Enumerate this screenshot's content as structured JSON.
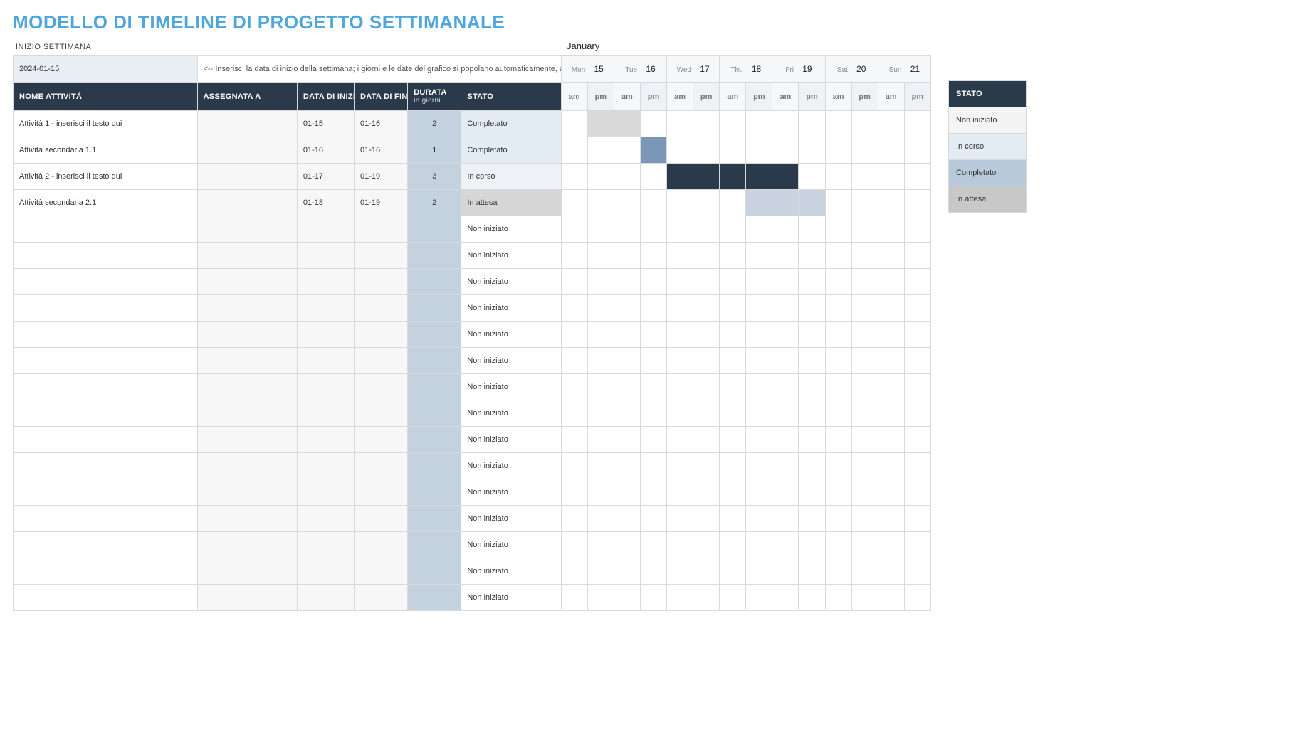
{
  "title": "MODELLO DI TIMELINE DI PROGETTO SETTIMANALE",
  "labels": {
    "week_start": "INIZIO SETTIMANA",
    "date_value": "2024-01-15",
    "instruction": "<-- Inserisci la data di inizio della settimana; i giorni e le date del grafico si popolano automaticamente, a destra.",
    "month": "January"
  },
  "columns": {
    "name": "NOME ATTIVITÀ",
    "assigned": "ASSEGNATA A",
    "start": "DATA DI INIZIO",
    "end": "DATA DI FINE",
    "duration": "DURATA",
    "duration_sub": "in giorni",
    "status": "STATO"
  },
  "days": [
    {
      "dow": "Mon",
      "num": "15"
    },
    {
      "dow": "Tue",
      "num": "16"
    },
    {
      "dow": "Wed",
      "num": "17"
    },
    {
      "dow": "Thu",
      "num": "18"
    },
    {
      "dow": "Fri",
      "num": "19"
    },
    {
      "dow": "Sat",
      "num": "20"
    },
    {
      "dow": "Sun",
      "num": "21"
    }
  ],
  "ampm": {
    "am": "am",
    "pm": "pm"
  },
  "rows": [
    {
      "name": "Attività 1 - inserisci il testo qui",
      "assigned": "",
      "start": "01-15",
      "end": "01-16",
      "dur": "2",
      "status": "Completato",
      "status_class": "stato-completato",
      "bar": {
        "from": 1,
        "to": 2,
        "class": "bar-complete-1"
      }
    },
    {
      "name": "Attività secondaria 1.1",
      "assigned": "",
      "start": "01-16",
      "end": "01-16",
      "dur": "1",
      "status": "Completato",
      "status_class": "stato-completato",
      "bar": {
        "from": 3,
        "to": 3,
        "class": "bar-complete-2"
      }
    },
    {
      "name": "Attività 2 - inserisci il testo qui",
      "assigned": "",
      "start": "01-17",
      "end": "01-19",
      "dur": "3",
      "status": "In corso",
      "status_class": "stato-incorso",
      "bar": {
        "from": 4,
        "to": 8,
        "class": "bar-inprogress"
      }
    },
    {
      "name": "Attività secondaria 2.1",
      "assigned": "",
      "start": "01-18",
      "end": "01-19",
      "dur": "2",
      "status": "In attesa",
      "status_class": "stato-attesa",
      "bar": {
        "from": 7,
        "to": 9,
        "class": "bar-wait"
      }
    },
    {
      "name": "",
      "assigned": "",
      "start": "",
      "end": "",
      "dur": "",
      "status": "Non iniziato",
      "status_class": "",
      "bar": null
    },
    {
      "name": "",
      "assigned": "",
      "start": "",
      "end": "",
      "dur": "",
      "status": "Non iniziato",
      "status_class": "",
      "bar": null
    },
    {
      "name": "",
      "assigned": "",
      "start": "",
      "end": "",
      "dur": "",
      "status": "Non iniziato",
      "status_class": "",
      "bar": null
    },
    {
      "name": "",
      "assigned": "",
      "start": "",
      "end": "",
      "dur": "",
      "status": "Non iniziato",
      "status_class": "",
      "bar": null
    },
    {
      "name": "",
      "assigned": "",
      "start": "",
      "end": "",
      "dur": "",
      "status": "Non iniziato",
      "status_class": "",
      "bar": null
    },
    {
      "name": "",
      "assigned": "",
      "start": "",
      "end": "",
      "dur": "",
      "status": "Non iniziato",
      "status_class": "",
      "bar": null
    },
    {
      "name": "",
      "assigned": "",
      "start": "",
      "end": "",
      "dur": "",
      "status": "Non iniziato",
      "status_class": "",
      "bar": null
    },
    {
      "name": "",
      "assigned": "",
      "start": "",
      "end": "",
      "dur": "",
      "status": "Non iniziato",
      "status_class": "",
      "bar": null
    },
    {
      "name": "",
      "assigned": "",
      "start": "",
      "end": "",
      "dur": "",
      "status": "Non iniziato",
      "status_class": "",
      "bar": null
    },
    {
      "name": "",
      "assigned": "",
      "start": "",
      "end": "",
      "dur": "",
      "status": "Non iniziato",
      "status_class": "",
      "bar": null
    },
    {
      "name": "",
      "assigned": "",
      "start": "",
      "end": "",
      "dur": "",
      "status": "Non iniziato",
      "status_class": "",
      "bar": null
    },
    {
      "name": "",
      "assigned": "",
      "start": "",
      "end": "",
      "dur": "",
      "status": "Non iniziato",
      "status_class": "",
      "bar": null
    },
    {
      "name": "",
      "assigned": "",
      "start": "",
      "end": "",
      "dur": "",
      "status": "Non iniziato",
      "status_class": "",
      "bar": null
    },
    {
      "name": "",
      "assigned": "",
      "start": "",
      "end": "",
      "dur": "",
      "status": "Non iniziato",
      "status_class": "",
      "bar": null
    },
    {
      "name": "",
      "assigned": "",
      "start": "",
      "end": "",
      "dur": "",
      "status": "Non iniziato",
      "status_class": "",
      "bar": null
    }
  ],
  "legend": {
    "header": "STATO",
    "items": [
      {
        "label": "Non iniziato",
        "class": "lg-noninit"
      },
      {
        "label": "In corso",
        "class": "lg-incorso"
      },
      {
        "label": "Completato",
        "class": "lg-complet"
      },
      {
        "label": "In attesa",
        "class": "lg-attesa"
      }
    ]
  }
}
